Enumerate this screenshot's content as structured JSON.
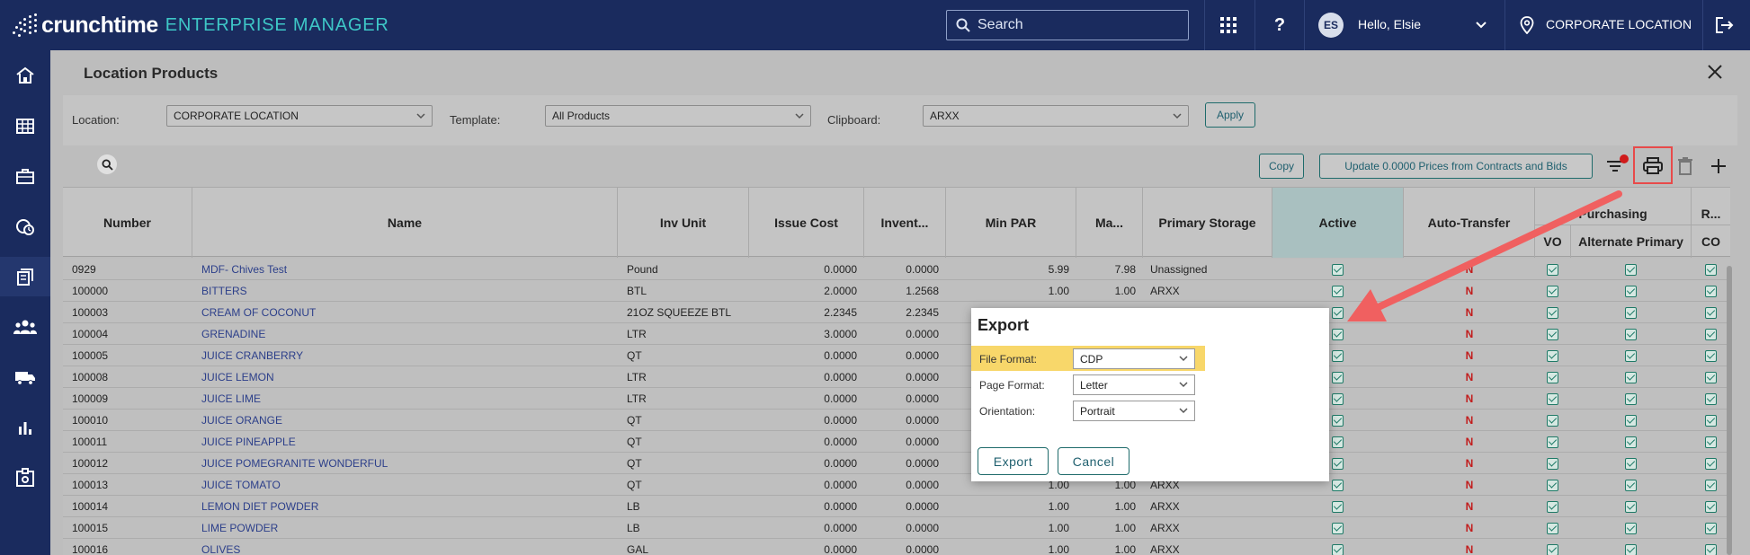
{
  "app": {
    "brand": "crunchtime",
    "product": "ENTERPRISE MANAGER"
  },
  "topbar": {
    "search_placeholder": "Search",
    "avatar_initials": "ES",
    "greeting": "Hello, Elsie",
    "location": "CORPORATE LOCATION"
  },
  "page": {
    "title": "Location Products"
  },
  "filters": {
    "location_label": "Location:",
    "location_value": "CORPORATE LOCATION",
    "template_label": "Template:",
    "template_value": "All Products",
    "clipboard_label": "Clipboard:",
    "clipboard_value": "ARXX",
    "apply_label": "Apply"
  },
  "toolbar": {
    "copy_label": "Copy",
    "update_prices_label": "Update 0.0000 Prices from Contracts and Bids"
  },
  "table": {
    "headers": {
      "number": "Number",
      "name": "Name",
      "inv_unit": "Inv Unit",
      "issue_cost": "Issue Cost",
      "inventory": "Invent...",
      "min_par": "Min PAR",
      "max": "Ma...",
      "primary_storage": "Primary Storage",
      "active": "Active",
      "auto_transfer": "Auto-Transfer",
      "purchasing": "Purchasing",
      "vo": "VO",
      "alternate_primary": "Alternate Primary",
      "r": "R...",
      "co": "CO"
    },
    "rows": [
      {
        "number": "0929",
        "name": "MDF- Chives Test",
        "unit": "Pound",
        "cost": "0.0000",
        "inv": "0.0000",
        "min": "5.99",
        "max": "7.98",
        "storage": "Unassigned",
        "auto": "N"
      },
      {
        "number": "100000",
        "name": "BITTERS",
        "unit": "BTL",
        "cost": "2.0000",
        "inv": "1.2568",
        "min": "1.00",
        "max": "1.00",
        "storage": "ARXX",
        "auto": "N"
      },
      {
        "number": "100003",
        "name": "CREAM OF COCONUT",
        "unit": "21OZ SQUEEZE BTL",
        "cost": "2.2345",
        "inv": "2.2345",
        "min": "",
        "max": "",
        "storage": "",
        "auto": "N"
      },
      {
        "number": "100004",
        "name": "GRENADINE",
        "unit": "LTR",
        "cost": "3.0000",
        "inv": "0.0000",
        "min": "",
        "max": "",
        "storage": "",
        "auto": "N"
      },
      {
        "number": "100005",
        "name": "JUICE CRANBERRY",
        "unit": "QT",
        "cost": "0.0000",
        "inv": "0.0000",
        "min": "",
        "max": "",
        "storage": "",
        "auto": "N"
      },
      {
        "number": "100008",
        "name": "JUICE LEMON",
        "unit": "LTR",
        "cost": "0.0000",
        "inv": "0.0000",
        "min": "",
        "max": "",
        "storage": "",
        "auto": "N"
      },
      {
        "number": "100009",
        "name": "JUICE LIME",
        "unit": "LTR",
        "cost": "0.0000",
        "inv": "0.0000",
        "min": "",
        "max": "",
        "storage": "",
        "auto": "N"
      },
      {
        "number": "100010",
        "name": "JUICE ORANGE",
        "unit": "QT",
        "cost": "0.0000",
        "inv": "0.0000",
        "min": "",
        "max": "",
        "storage": "",
        "auto": "N"
      },
      {
        "number": "100011",
        "name": "JUICE PINEAPPLE",
        "unit": "QT",
        "cost": "0.0000",
        "inv": "0.0000",
        "min": "",
        "max": "",
        "storage": "",
        "auto": "N"
      },
      {
        "number": "100012",
        "name": "JUICE POMEGRANITE WONDERFUL",
        "unit": "QT",
        "cost": "0.0000",
        "inv": "0.0000",
        "min": "",
        "max": "",
        "storage": "",
        "auto": "N"
      },
      {
        "number": "100013",
        "name": "JUICE TOMATO",
        "unit": "QT",
        "cost": "0.0000",
        "inv": "0.0000",
        "min": "1.00",
        "max": "1.00",
        "storage": "ARXX",
        "auto": "N"
      },
      {
        "number": "100014",
        "name": "LEMON DIET POWDER",
        "unit": "LB",
        "cost": "0.0000",
        "inv": "0.0000",
        "min": "1.00",
        "max": "1.00",
        "storage": "ARXX",
        "auto": "N"
      },
      {
        "number": "100015",
        "name": "LIME POWDER",
        "unit": "LB",
        "cost": "0.0000",
        "inv": "0.0000",
        "min": "1.00",
        "max": "1.00",
        "storage": "ARXX",
        "auto": "N"
      },
      {
        "number": "100016",
        "name": "OLIVES",
        "unit": "GAL",
        "cost": "0.0000",
        "inv": "0.0000",
        "min": "1.00",
        "max": "1.00",
        "storage": "ARXX",
        "auto": "N"
      }
    ]
  },
  "export_dialog": {
    "title": "Export",
    "file_format_label": "File Format:",
    "file_format_value": "CDP",
    "page_format_label": "Page Format:",
    "page_format_value": "Letter",
    "orientation_label": "Orientation:",
    "orientation_value": "Portrait",
    "export_label": "Export",
    "cancel_label": "Cancel"
  },
  "colors": {
    "topbar": "#1a2b5e",
    "brand_accent": "#3ec7c7",
    "highlight": "#f8d76a",
    "annotation_arrow": "#f06060",
    "flag_n": "#c21d1d"
  }
}
